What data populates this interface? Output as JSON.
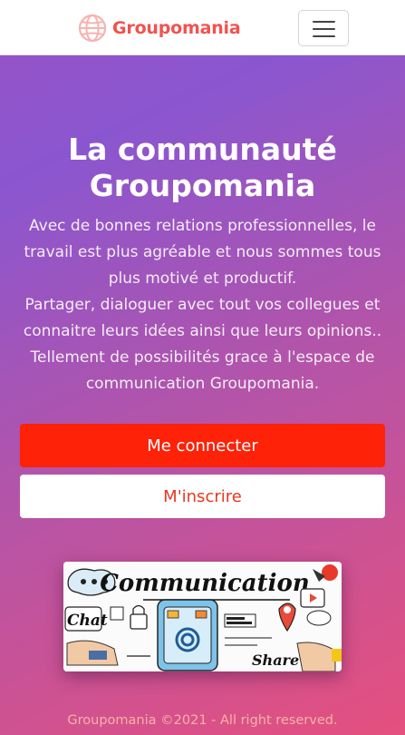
{
  "navbar": {
    "brand_name": "Groupomania",
    "logo_icon": "globe-icon",
    "menu_icon": "hamburger-icon",
    "brand_color": "#f0534f"
  },
  "hero": {
    "title_line1": "La communauté",
    "title_line2": "Groupomania",
    "paragraph_lines": [
      "Avec de bonnes relations professionnelles, le",
      "travail est plus agréable et nous sommes tous",
      "plus motivé et productif.",
      "Partager, dialoguer avec tout vos collegues et",
      "connaitre leurs idées ainsi que leurs opinions..",
      "Tellement de possibilités grace à l'espace de",
      "communication Groupomania."
    ]
  },
  "actions": {
    "login_label": "Me connecter",
    "signup_label": "M'inscrire",
    "login_color": "#fe2208"
  },
  "banner": {
    "headline": "Communication",
    "chat_label": "Chat",
    "share_label": "Share"
  },
  "footer": {
    "copyright": "Groupomania ©2021 - All right reserved."
  }
}
